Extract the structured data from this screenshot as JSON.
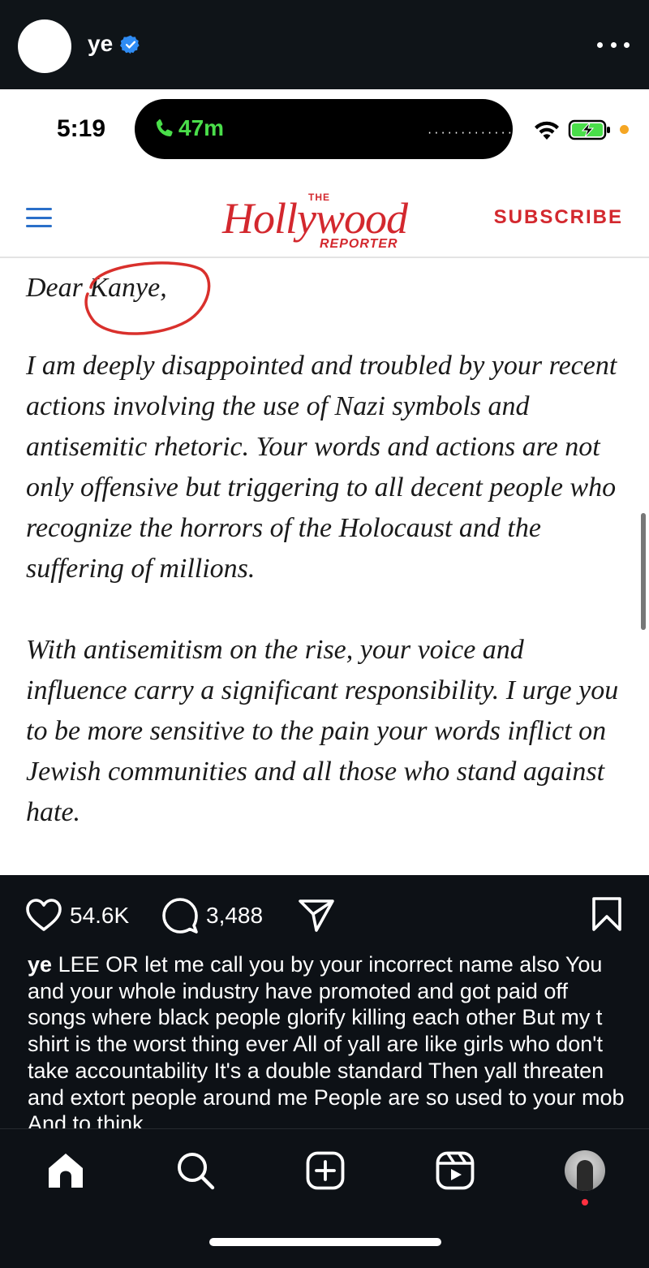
{
  "post_header": {
    "username": "ye",
    "verified": true,
    "icons": {
      "verified": "verified-badge-icon",
      "more": "more-options-icon"
    }
  },
  "screenshot": {
    "status_bar": {
      "time": "5:19",
      "call_duration": "47m",
      "icons": [
        "phone-icon",
        "wifi-icon",
        "battery-charging-icon"
      ]
    },
    "site": {
      "logo_the": "THE",
      "logo_main": "Hollywood",
      "logo_reporter": "REPORTER",
      "subscribe_label": "SUBSCRIBE",
      "menu_icon": "hamburger-menu-icon"
    },
    "letter": {
      "salutation": "Dear Kanye,",
      "paragraphs": [
        "I am deeply disappointed and troubled by your recent actions involving the use of Nazi symbols and antisemitic rhetoric. Your words and actions are not only offensive but triggering to all decent people who recognize the horrors of the Holocaust and the suffering of millions.",
        "With antisemitism on the rise, your voice and influence carry a significant responsibility. I urge you to be more sensitive to the pain your words inflict on Jewish communities and all those who stand against hate."
      ],
      "annotation": "red-circle-around-name",
      "annotation_color": "#d9302c"
    }
  },
  "actions": {
    "likes": "54.6K",
    "comments": "3,488",
    "icons": [
      "heart-icon",
      "comment-icon",
      "share-icon",
      "bookmark-icon"
    ]
  },
  "caption": {
    "username": "ye",
    "text": "LEE OR  let me call you by your incorrect name also You and your whole industry have promoted and got paid off songs where black people glorify killing each other  But my t shirt is the worst thing ever  All of yall are like girls who don't take accountability  It's a double standard  Then yall threaten and extort people around me  People are so used to your mob  And to think"
  },
  "bottom_nav": {
    "items": [
      "home-icon",
      "search-icon",
      "create-post-icon",
      "reels-icon",
      "profile-avatar"
    ],
    "notification_dot_color": "#ff3040"
  },
  "colors": {
    "thr_red": "#d3282e",
    "call_green": "#4ade4a",
    "menu_blue": "#2a6fc9",
    "verified_blue": "#2f8cf4",
    "app_bg": "#0d1116"
  }
}
